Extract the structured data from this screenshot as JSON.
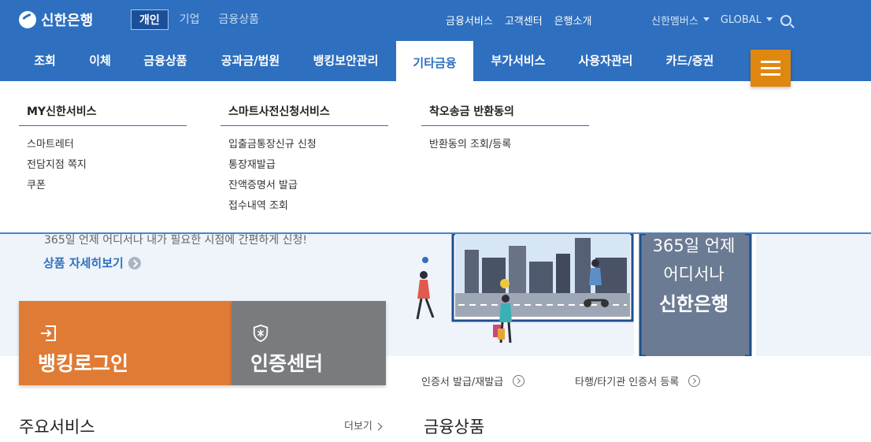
{
  "header": {
    "logo": "신한은행",
    "segments": [
      "개인",
      "기업",
      "금융상품"
    ],
    "utility_links": [
      "금융서비스",
      "고객센터",
      "은행소개"
    ],
    "family_site": "신한멤버스",
    "global": "GLOBAL"
  },
  "nav": {
    "items": [
      "조회",
      "이체",
      "금융상품",
      "공과금/법원",
      "뱅킹보안관리",
      "기타금융",
      "부가서비스",
      "사용자관리",
      "카드/증권"
    ],
    "active": "기타금융"
  },
  "dropdown": {
    "columns": [
      {
        "title": "MY신한서비스",
        "links": [
          "스마트레터",
          "전담지점 쪽지",
          "쿠폰"
        ]
      },
      {
        "title": "스마트사전신청서비스",
        "links": [
          "입출금통장신규 신청",
          "통장재발급",
          "잔액증명서 발급",
          "접수내역 조회"
        ]
      },
      {
        "title": "착오송금 반환동의",
        "links": [
          "반환동의 조회/등록"
        ]
      }
    ]
  },
  "banner": {
    "text": "365일 언제 어디서나 내가 필요한 시점에 간편하게 신청!",
    "more_link": "상품 자세히보기",
    "sign_line1": "365일 언제",
    "sign_line2": "어디서나",
    "sign_line3": "신한은행"
  },
  "login": {
    "banking_login": "뱅킹로그인",
    "cert_center": "인증센터",
    "banking_color": "#e07b35",
    "cert_color": "#7a7b7f"
  },
  "cert_links": [
    "인증서 발급/재발급",
    "타행/타기관 인증서 등록"
  ],
  "sections": {
    "main_services": "주요서비스",
    "more": "더보기",
    "financial_products": "금융상품"
  },
  "colors": {
    "brand_blue": "#2e6fbf",
    "menu_orange": "#e0870f"
  }
}
